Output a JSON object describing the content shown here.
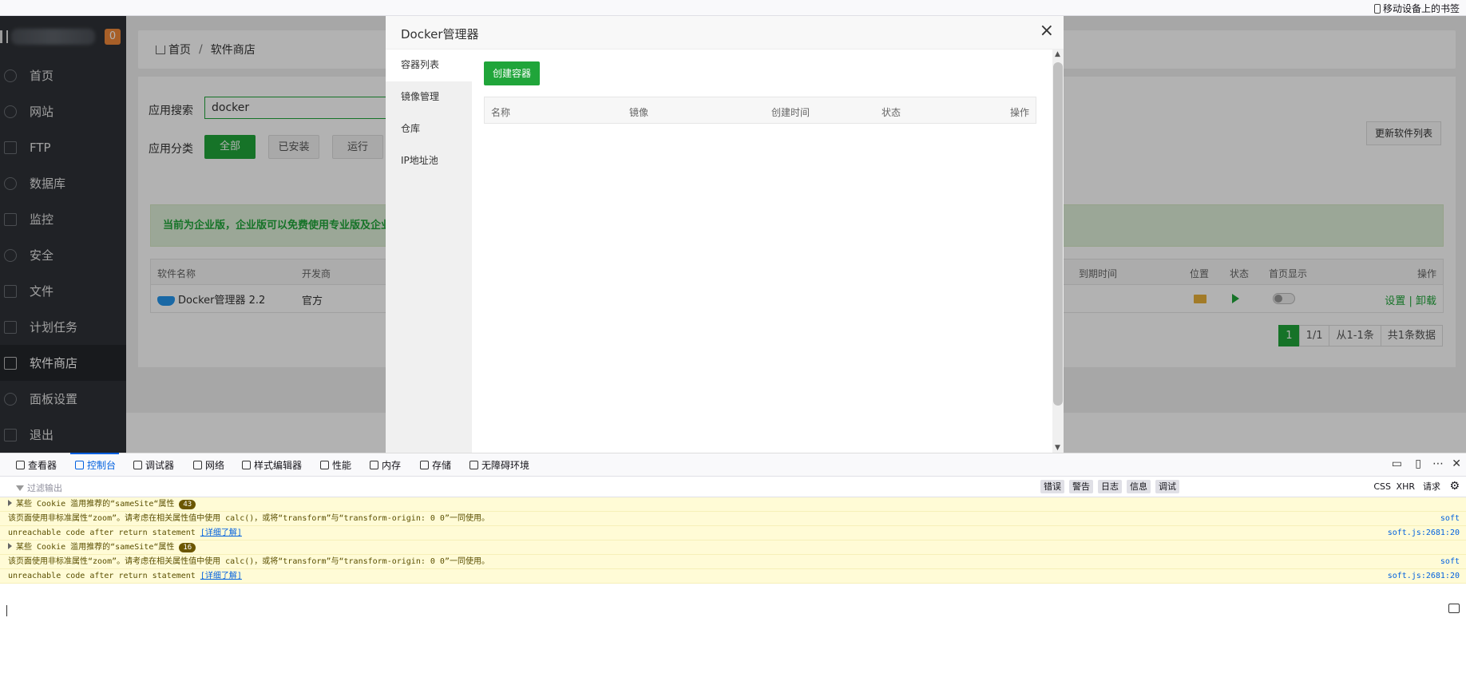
{
  "bookmarks": {
    "mobile_label": "移动设备上的书签"
  },
  "sidebar": {
    "badge": "0",
    "items": [
      {
        "label": "首页",
        "icon": "home-icon"
      },
      {
        "label": "网站",
        "icon": "globe-icon"
      },
      {
        "label": "FTP",
        "icon": "ftp-icon"
      },
      {
        "label": "数据库",
        "icon": "database-icon"
      },
      {
        "label": "监控",
        "icon": "monitor-icon"
      },
      {
        "label": "安全",
        "icon": "shield-icon"
      },
      {
        "label": "文件",
        "icon": "folder-icon"
      },
      {
        "label": "计划任务",
        "icon": "calendar-icon"
      },
      {
        "label": "软件商店",
        "icon": "apps-icon"
      },
      {
        "label": "面板设置",
        "icon": "gear-icon"
      },
      {
        "label": "退出",
        "icon": "logout-icon"
      }
    ]
  },
  "breadcrumb": {
    "home": "首页",
    "separator": "/",
    "current": "软件商店"
  },
  "store": {
    "search_label": "应用搜索",
    "search_value": "docker",
    "category_label": "应用分类",
    "categories": [
      "全部",
      "已安装",
      "运行"
    ],
    "update_button": "更新软件列表",
    "notice": "当前为企业版，企业版可以免费使用专业版及企业版",
    "table_headers": {
      "name": "软件名称",
      "developer": "开发商",
      "expire": "到期时间",
      "location": "位置",
      "status": "状态",
      "homepage": "首页显示",
      "action": "操作"
    },
    "row": {
      "name": "Docker管理器 2.2",
      "developer": "官方",
      "settings": "设置",
      "pipe": "|",
      "uninstall": "卸载"
    },
    "pager": {
      "current": "1",
      "pages": "1/1",
      "range": "从1-1条",
      "total": "共1条数据"
    }
  },
  "modal": {
    "title": "Docker管理器",
    "close": "×",
    "tabs": [
      "容器列表",
      "镜像管理",
      "仓库",
      "IP地址池"
    ],
    "create_button": "创建容器",
    "columns": [
      "名称",
      "镜像",
      "创建时间",
      "状态",
      "操作"
    ]
  },
  "devtools": {
    "tabs": [
      "查看器",
      "控制台",
      "调试器",
      "网络",
      "样式编辑器",
      "性能",
      "内存",
      "存储",
      "无障碍环境"
    ],
    "filter_placeholder": "过滤输出",
    "filters": [
      "错误",
      "警告",
      "日志",
      "信息",
      "调试",
      "CSS",
      "XHR",
      "请求"
    ],
    "messages": [
      {
        "text": "某些 Cookie 滥用推荐的“sameSite“属性",
        "count": "43",
        "src": ""
      },
      {
        "text": "该页面使用非标准属性“zoom”。请考虑在相关属性值中使用 calc()，或将“transform”与“transform-origin: 0 0”一同使用。",
        "src": "soft"
      },
      {
        "text": "unreachable code after return statement",
        "link": "[详细了解]",
        "src": "soft.js:2681:20"
      },
      {
        "text": "某些 Cookie 滥用推荐的“sameSite“属性",
        "count": "16",
        "src": ""
      },
      {
        "text": "该页面使用非标准属性“zoom”。请考虑在相关属性值中使用 calc()，或将“transform”与“transform-origin: 0 0”一同使用。",
        "src": "soft"
      },
      {
        "text": "unreachable code after return statement",
        "link": "[详细了解]",
        "src": "soft.js:2681:20"
      }
    ]
  },
  "colors": {
    "accent": "#20a53a",
    "sidebar": "#2f3237",
    "devtools_accent": "#0060df"
  }
}
